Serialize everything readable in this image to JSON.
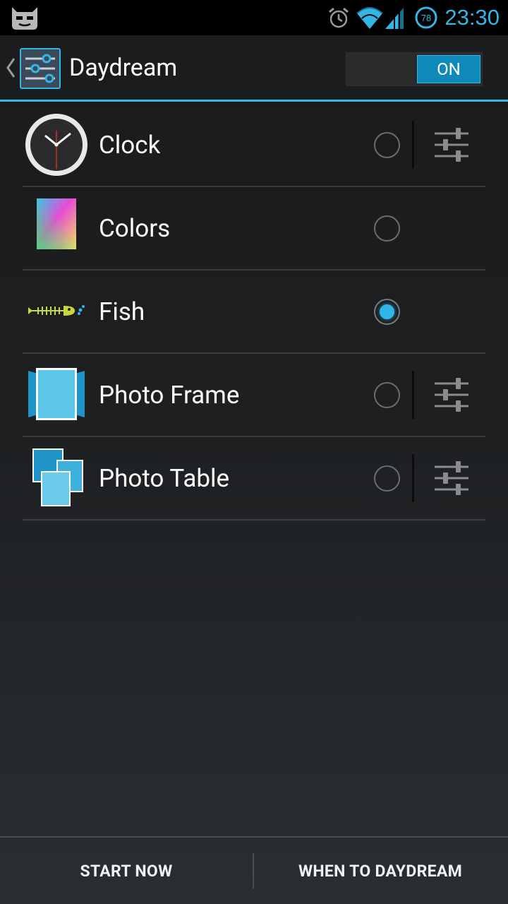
{
  "status_bar": {
    "time": "23:30",
    "battery_level": "78",
    "icons": [
      "cyanogenmod-icon",
      "alarm-icon",
      "wifi-icon",
      "signal-icon",
      "battery-icon"
    ],
    "accent_color": "#33b5e5"
  },
  "action_bar": {
    "title": "Daydream",
    "icon": "settings-sliders-icon",
    "toggle": {
      "label": "ON",
      "state": true
    }
  },
  "daydreams": [
    {
      "label": "Clock",
      "icon": "clock-icon",
      "selected": false,
      "has_settings": true
    },
    {
      "label": "Colors",
      "icon": "colors-icon",
      "selected": false,
      "has_settings": false
    },
    {
      "label": "Fish",
      "icon": "fish-icon",
      "selected": true,
      "has_settings": false
    },
    {
      "label": "Photo Frame",
      "icon": "photo-frame-icon",
      "selected": false,
      "has_settings": true
    },
    {
      "label": "Photo Table",
      "icon": "photo-table-icon",
      "selected": false,
      "has_settings": true
    }
  ],
  "bottom_bar": {
    "start_now": "START NOW",
    "when_to_daydream": "WHEN TO DAYDREAM"
  }
}
